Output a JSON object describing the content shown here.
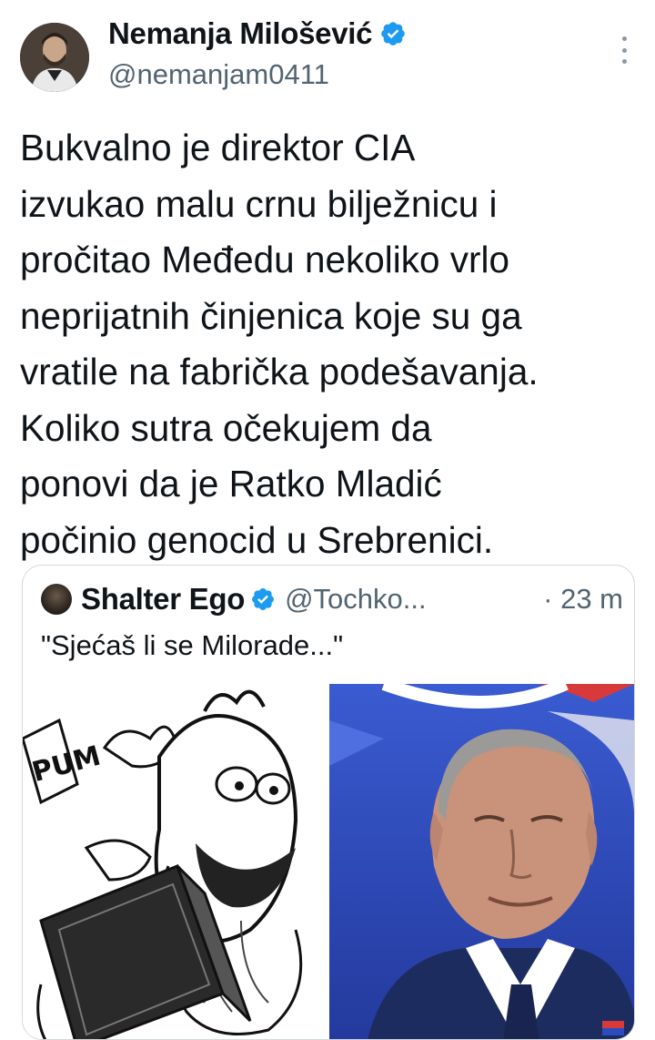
{
  "tweet": {
    "author_name": "Nemanja Milošević",
    "author_handle": "@nemanjam0411",
    "text": "Bukvalno je direktor CIA\nizvukao malu crnu bilježnicu i\npročitao Međedu nekoliko vrlo\nneprijatnih činjenica koje su ga\nvratile na fabrička podešavanja.\nKoliko sutra očekujem da\nponovi da je Ratko Mladić\npočinio genocid u Srebrenici."
  },
  "quoted": {
    "author_name": "Shalter Ego",
    "author_handle": "@Tochko...",
    "time": "· 23 m",
    "text": "\"Sjećaš li se Milorade...\"",
    "comic_sound": "PUM"
  },
  "colors": {
    "verified_blue": "#1d9bf0",
    "secondary_text": "#536471",
    "border": "#cfd9de"
  },
  "icons": {
    "verified": "verified-badge-icon",
    "more": "more-vertical-icon"
  }
}
